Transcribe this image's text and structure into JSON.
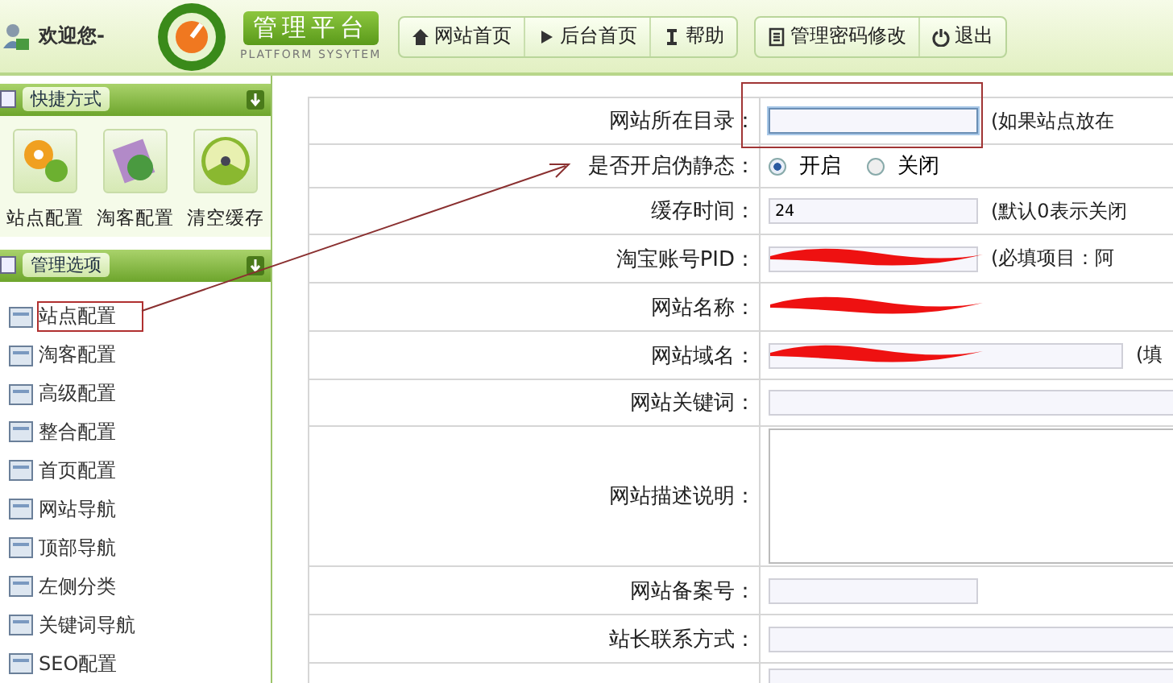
{
  "header": {
    "welcome": "欢迎您-",
    "logo_title": "管理平台",
    "logo_subtitle": "PLATFORM SYSYTEM",
    "nav_groups": [
      [
        {
          "label": "网站首页"
        },
        {
          "label": "后台首页"
        },
        {
          "label": "帮助"
        }
      ],
      [
        {
          "label": "管理密码修改"
        },
        {
          "label": "退出"
        }
      ]
    ]
  },
  "sidebar": {
    "shortcuts_title": "快捷方式",
    "shortcuts": [
      {
        "label": "站点配置"
      },
      {
        "label": "淘客配置"
      },
      {
        "label": "清空缓存"
      }
    ],
    "manage_title": "管理选项",
    "items": [
      {
        "label": "站点配置",
        "selected": true
      },
      {
        "label": "淘客配置",
        "selected": false
      },
      {
        "label": "高级配置",
        "selected": false
      },
      {
        "label": "整合配置",
        "selected": false
      },
      {
        "label": "首页配置",
        "selected": false
      },
      {
        "label": "网站导航",
        "selected": false
      },
      {
        "label": "顶部导航",
        "selected": false
      },
      {
        "label": "左侧分类",
        "selected": false
      },
      {
        "label": "关键词导航",
        "selected": false
      },
      {
        "label": "SEO配置",
        "selected": false
      }
    ]
  },
  "form": [
    {
      "label": "网站所在目录：",
      "kind": "input",
      "focused": true,
      "note": "(如果站点放在"
    },
    {
      "label": "是否开启伪静态：",
      "kind": "radio",
      "options": [
        {
          "label": "开启",
          "selected": true
        },
        {
          "label": "关闭",
          "selected": false
        }
      ]
    },
    {
      "label": "缓存时间：",
      "kind": "input",
      "value": "24",
      "note": "(默认0表示关闭"
    },
    {
      "label": "淘宝账号PID：",
      "kind": "input",
      "redacted": true,
      "note": "(必填项目：阿"
    },
    {
      "label": "网站名称：",
      "kind": "plain",
      "redacted": true
    },
    {
      "label": "网站域名：",
      "kind": "input",
      "redacted": true,
      "note": "(填"
    },
    {
      "label": "网站关键词：",
      "kind": "input"
    },
    {
      "label": "网站描述说明：",
      "kind": "textarea"
    },
    {
      "label": "网站备案号：",
      "kind": "input"
    },
    {
      "label": "站长联系方式：",
      "kind": "input"
    },
    {
      "kind": "code"
    }
  ]
}
